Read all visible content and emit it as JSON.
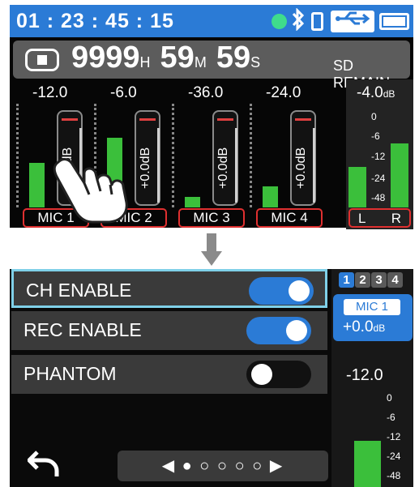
{
  "status_bar": {
    "timecode": "01 : 23 : 45 : 15",
    "bluetooth_symbol": "∗",
    "usb_symbol": "⇌",
    "accent_color": "#2b7bd6",
    "connected_dot_color": "#3fdc8c"
  },
  "remain": {
    "hours": "9999",
    "hours_unit": "H",
    "minutes": "59",
    "minutes_unit": "M",
    "seconds": "59",
    "seconds_unit": "S",
    "label": "SD REMAIN"
  },
  "channels": [
    {
      "level": "-12.0",
      "fader_value": "+0.0dB",
      "label": "MIC 1",
      "meter_fraction": 0.42
    },
    {
      "level": "-6.0",
      "fader_value": "+0.0dB",
      "label": "MIC 2",
      "meter_fraction": 0.66
    },
    {
      "level": "-36.0",
      "fader_value": "+0.0dB",
      "label": "MIC 3",
      "meter_fraction": 0.1
    },
    {
      "level": "-24.0",
      "fader_value": "+0.0dB",
      "label": "MIC 4",
      "meter_fraction": 0.2
    }
  ],
  "master": {
    "level_value": "-4.0",
    "level_unit": "dB",
    "scale": [
      "0",
      "-6",
      "-12",
      "-24",
      "-48"
    ],
    "left_label": "L",
    "right_label": "R",
    "left_fraction": 0.45,
    "right_fraction": 0.72
  },
  "menu": {
    "items": [
      {
        "label": "CH ENABLE",
        "enabled": true,
        "selected": true
      },
      {
        "label": "REC ENABLE",
        "enabled": true,
        "selected": false
      },
      {
        "label": "PHANTOM",
        "enabled": false,
        "selected": false
      }
    ],
    "pager_text": "◀ ● ○ ○ ○ ○ ▶",
    "page_index": 1,
    "page_count": 5
  },
  "side_panel": {
    "tabs": [
      "1",
      "2",
      "3",
      "4"
    ],
    "active_tab": "1",
    "mic_name": "MIC 1",
    "gain_value": "+0.0",
    "gain_unit": "dB",
    "level": "-12.0",
    "scale": [
      "0",
      "-6",
      "-12",
      "-24",
      "-48"
    ]
  },
  "colors": {
    "meter_green": "#3bbf3b",
    "label_red": "#e03030",
    "toggle_on": "#2b7bd6",
    "selection_outline": "#7fd0e8"
  }
}
